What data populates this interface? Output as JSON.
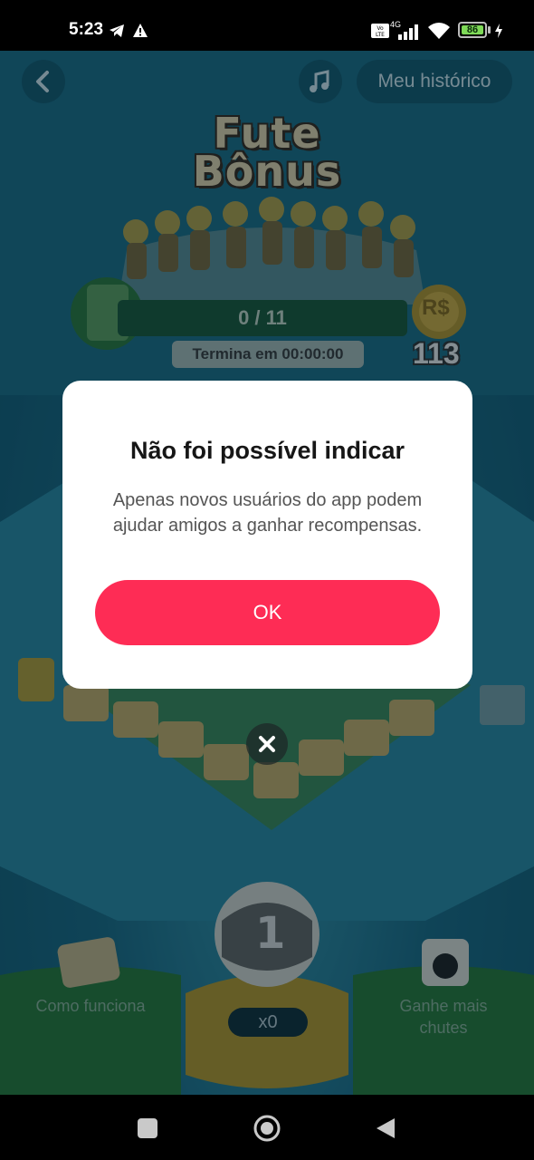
{
  "status_bar": {
    "time": "5:23",
    "battery": "86",
    "network": "4G",
    "icons": [
      "telegram-icon",
      "warning-icon",
      "volte-icon",
      "signal-icon",
      "wifi-icon",
      "battery-icon",
      "charging-icon"
    ]
  },
  "game": {
    "history_label": "Meu histórico",
    "title_line1": "Fute",
    "title_line2": "Bônus",
    "progress_text": "0 / 11",
    "ends_text": "Termina em 00:00:00",
    "coin_label": "R$",
    "coin_count": "113",
    "how_label": "Como funciona",
    "earn_label": "Ganhe mais chutes",
    "kick_count": "x0",
    "ball_number": "1"
  },
  "modal": {
    "title": "Não foi possível indicar",
    "message": "Apenas novos usuários do app podem ajudar amigos a ganhar recompensas.",
    "ok_label": "OK"
  },
  "colors": {
    "accent": "#fe2c55",
    "modal_bg": "#ffffff",
    "backdrop": "#135a72"
  }
}
